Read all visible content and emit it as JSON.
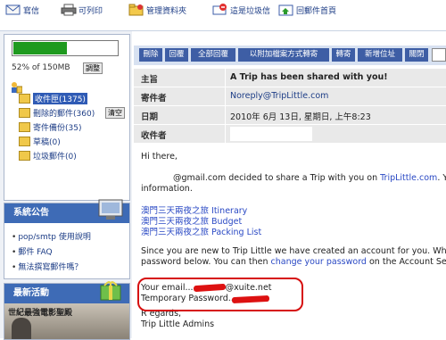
{
  "toolbar": {
    "items": [
      {
        "label": "寫信",
        "icon": "compose-icon"
      },
      {
        "label": "可列印",
        "icon": "printer-icon"
      },
      {
        "label": "管理資料夾",
        "icon": "folder-manage-icon"
      },
      {
        "label": "這是垃圾信",
        "icon": "spam-icon"
      },
      {
        "label": "回郵件首頁",
        "icon": "home-mail-icon"
      }
    ]
  },
  "quota": {
    "percent": 52,
    "text": "52% of 150MB",
    "button": "調整"
  },
  "folders": [
    {
      "label": "收件匣(1375)",
      "selected": true
    },
    {
      "label": "刪除的郵件(360)",
      "extra": "清空"
    },
    {
      "label": "寄件備份(35)"
    },
    {
      "label": "草稿(0)"
    },
    {
      "label": "垃圾郵件(0)"
    }
  ],
  "announcements": {
    "title": "系統公告",
    "links": [
      "pop/smtp 使用說明",
      "郵件 FAQ",
      "無法撰寫郵件嗎？"
    ]
  },
  "activities": {
    "title": "最新活動",
    "banner": "世紀最強電影聖殿"
  },
  "actions": [
    "刪除",
    "回覆",
    "全部回覆",
    "以附加檔案方式轉寄",
    "轉寄",
    "新增位址",
    "關閉"
  ],
  "header": {
    "subject_label": "主旨",
    "subject": "A Trip has been shared with you!",
    "from_label": "寄件者",
    "from": "Noreply@TripLittle.com",
    "date_label": "日期",
    "date": "2010年 6月 13日, 星期日, 上午8:23",
    "to_label": "收件者",
    "to": ""
  },
  "message": {
    "greeting": "Hi there,",
    "line1_pre": "@gmail.com decided to share a Trip with you on ",
    "line1_link": "TripLittle.com",
    "line1_post": ". You",
    "line2": "information.",
    "links": [
      "澳門三天兩夜之旅 Itinerary",
      "澳門三天兩夜之旅 Budget",
      "澳門三天兩夜之旅 Packing List"
    ],
    "p2_line1": "Since you are new to Trip Little we have created an account for you. When y",
    "p2_line2_pre": "password below. You can then ",
    "p2_line2_link": "change your password",
    "p2_line2_post": " on the Account Setti",
    "email_pre": "Your email...",
    "email_post": "@xuite.net",
    "password_pre": "Temporary Password...",
    "regards": "R egards,",
    "signature": "Trip Little Admins"
  },
  "colors": {
    "action_button": "#3e5ea5",
    "panel_header": "#3e6bb6",
    "quota_fill": "#1f9a1f",
    "highlight": "#d60e0e"
  }
}
